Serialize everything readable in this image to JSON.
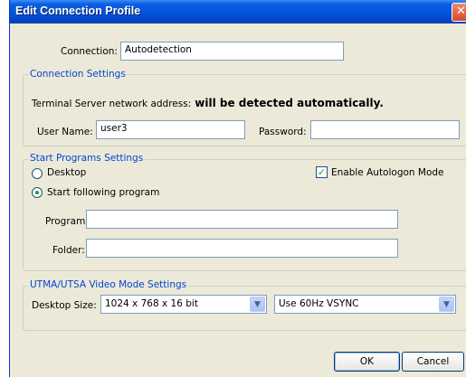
{
  "window": {
    "title": "Edit Connection Profile"
  },
  "connection": {
    "label": "Connection:",
    "value": "Autodetection"
  },
  "connection_settings": {
    "legend": "Connection Settings",
    "server_label": "Terminal Server network address:",
    "server_value": "will be detected automatically.",
    "username_label": "User Name:",
    "username_value": "user3",
    "password_label": "Password:",
    "password_value": ""
  },
  "start_programs": {
    "legend": "Start Programs  Settings",
    "desktop_label": "Desktop",
    "start_program_label": "Start following program",
    "autologon_label": "Enable Autologon Mode",
    "program_label": "Program:",
    "program_value": "",
    "folder_label": "Folder:",
    "folder_value": ""
  },
  "video_mode": {
    "legend": "UTMA/UTSA  Video Mode Settings",
    "desktop_size_label": "Desktop Size:",
    "desktop_size_value": "1024 x 768 x 16 bit",
    "vsync_value": "Use 60Hz VSYNC"
  },
  "buttons": {
    "ok": "OK",
    "cancel": "Cancel"
  }
}
